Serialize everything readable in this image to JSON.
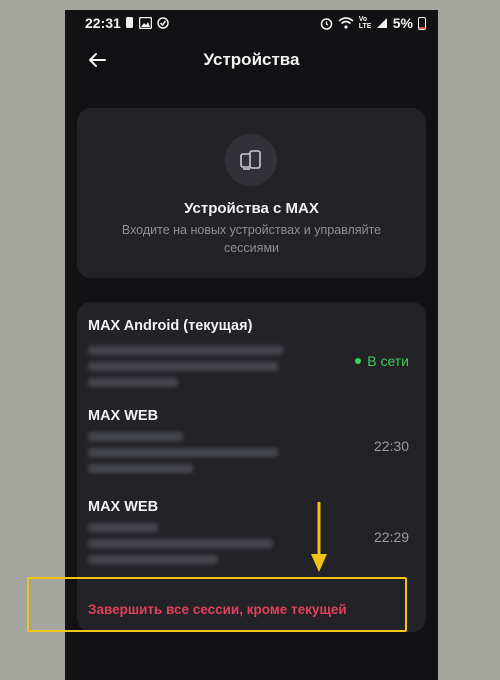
{
  "status_bar": {
    "time": "22:31",
    "battery": "5%",
    "network_label": "Vo LTE",
    "left_icons": [
      "notification-icon",
      "gallery-icon",
      "check-circle-icon"
    ],
    "right_icons": [
      "alarm-icon",
      "wifi-icon",
      "signal-icon",
      "battery-icon"
    ]
  },
  "header": {
    "title": "Устройства",
    "back_icon": "arrow-left-icon"
  },
  "hero": {
    "icon": "devices-icon",
    "title": "Устройства с MAX",
    "subtitle": "Входите на новых устройствах и управляйте сессиями"
  },
  "sessions": [
    {
      "name": "MAX Android (текущая)",
      "status": "В сети",
      "online": true
    },
    {
      "name": "MAX WEB",
      "status": "22:30",
      "online": false
    },
    {
      "name": "MAX WEB",
      "status": "22:29",
      "online": false
    }
  ],
  "actions": {
    "terminate_all": "Завершить все сессии, кроме текущей"
  },
  "colors": {
    "background": "#121215",
    "card": "#222227",
    "online": "#3fcf5a",
    "danger": "#e0405e",
    "annotation": "#f3c416"
  }
}
